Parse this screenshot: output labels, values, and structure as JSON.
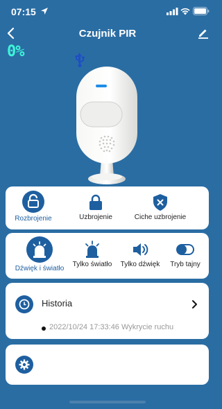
{
  "status_bar": {
    "time": "07:15"
  },
  "header": {
    "title": "Czujnik PIR"
  },
  "device": {
    "battery_text": "0%"
  },
  "modes": [
    {
      "label": "Rozbrojenie",
      "active": true
    },
    {
      "label": "Uzbrojenie",
      "active": false
    },
    {
      "label": "Ciche uzbrojenie",
      "active": false
    }
  ],
  "alarms": [
    {
      "label": "Dźwięk i światło",
      "active": true
    },
    {
      "label": "Tylko światło",
      "active": false
    },
    {
      "label": "Tylko dźwięk",
      "active": false
    },
    {
      "label": "Tryb tajny",
      "active": false
    }
  ],
  "history": {
    "label": "Historia",
    "latest_entry": "2022/10/24 17:33:46 Wykrycie ruchu"
  },
  "colors": {
    "background": "#2a6da3",
    "accent": "#1e5fa0",
    "battery_text": "#3ef5d8"
  }
}
